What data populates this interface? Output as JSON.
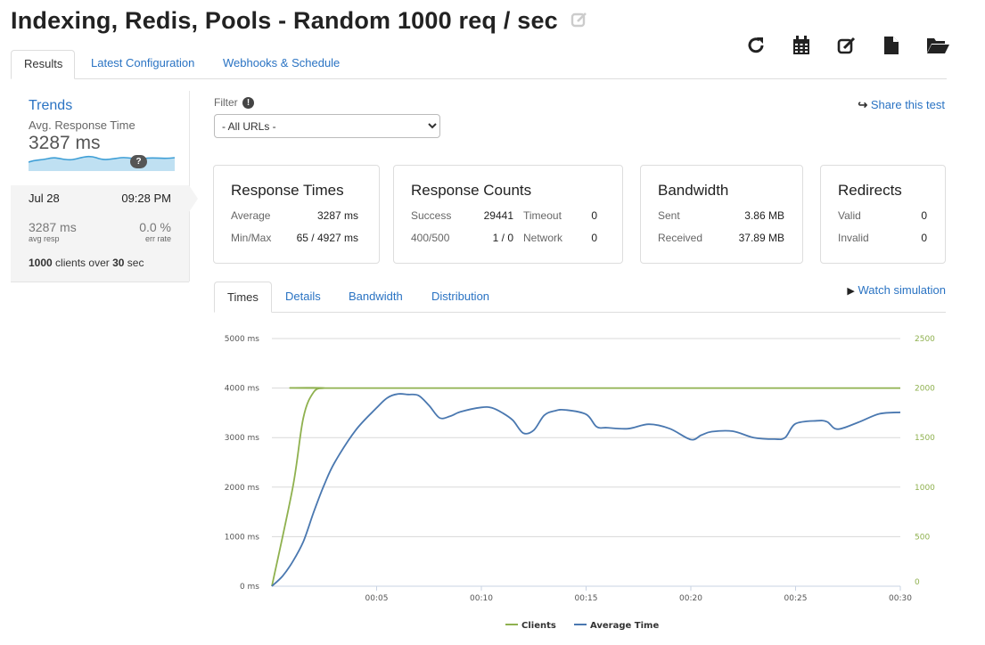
{
  "header": {
    "title": "Indexing, Redis, Pools - Random 1000 req / sec",
    "edit_icon": "edit-icon",
    "toolbar_icons": [
      "refresh-icon",
      "calendar-icon",
      "edit-icon",
      "file-icon",
      "folder-open-icon"
    ]
  },
  "top_tabs": [
    "Results",
    "Latest Configuration",
    "Webhooks & Schedule"
  ],
  "sidebar": {
    "trends_label": "Trends",
    "avg_label": "Avg. Response Time",
    "avg_value": "3287 ms",
    "help_badge": "?",
    "date": "Jul 28",
    "time": "09:28 PM",
    "resp_value": "3287 ms",
    "resp_caption": "avg resp",
    "err_value": "0.0 %",
    "err_caption": "err rate",
    "clients_count": "1000",
    "clients_text": "clients over",
    "duration": "30",
    "duration_unit": "sec"
  },
  "filter": {
    "label": "Filter",
    "info_glyph": "!",
    "selected": "- All URLs -"
  },
  "share_label": "Share this test",
  "cards": {
    "response_times": {
      "title": "Response Times",
      "average_label": "Average",
      "average_value": "3287 ms",
      "minmax_label": "Min/Max",
      "minmax_value": "65 / 4927 ms"
    },
    "response_counts": {
      "title": "Response Counts",
      "success_label": "Success",
      "success_value": "29441",
      "timeout_label": "Timeout",
      "timeout_value": "0",
      "err_label": "400/500",
      "err_value": "1 / 0",
      "network_label": "Network",
      "network_value": "0"
    },
    "bandwidth": {
      "title": "Bandwidth",
      "sent_label": "Sent",
      "sent_value": "3.86 MB",
      "received_label": "Received",
      "received_value": "37.89 MB"
    },
    "redirects": {
      "title": "Redirects",
      "valid_label": "Valid",
      "valid_value": "0",
      "invalid_label": "Invalid",
      "invalid_value": "0"
    }
  },
  "chart_tabs": [
    "Times",
    "Details",
    "Bandwidth",
    "Distribution"
  ],
  "watch_label": "Watch simulation",
  "colors": {
    "accent": "#2a73c3",
    "clients": "#8fb14f",
    "avg_time": "#4a78b0",
    "spark_fill": "#bfe0f2",
    "spark_line": "#3f9fd6"
  },
  "chart_data": {
    "type": "line",
    "x_ticks": [
      "00:05",
      "00:10",
      "00:15",
      "00:20",
      "00:25",
      "00:30"
    ],
    "y_left_ticks": [
      "0 ms",
      "1000 ms",
      "2000 ms",
      "3000 ms",
      "4000 ms",
      "5000 ms"
    ],
    "y_right_ticks": [
      "0",
      "500",
      "1000",
      "1500",
      "2000",
      "2500"
    ],
    "ylim_left": [
      0,
      5000
    ],
    "ylim_right": [
      0,
      2500
    ],
    "xlim": [
      0,
      30
    ],
    "grid": true,
    "legend_position": "bottom-center",
    "series": [
      {
        "name": "Clients",
        "axis": "right",
        "x": [
          0,
          1,
          1.5,
          2,
          2.5,
          3,
          30
        ],
        "values": [
          0,
          1000,
          1700,
          1960,
          2000,
          2000,
          2000
        ]
      },
      {
        "name": "Average Time",
        "axis": "left",
        "x": [
          0,
          0.5,
          1,
          1.5,
          2,
          2.5,
          3,
          4,
          5,
          5.5,
          6,
          6.5,
          7,
          7.5,
          8,
          8.5,
          9,
          10,
          10.5,
          11,
          11.5,
          12,
          12.5,
          13,
          13.5,
          14,
          15,
          15.5,
          16,
          17,
          18,
          19,
          20,
          20.5,
          21,
          22,
          23,
          24,
          24.5,
          25,
          26,
          26.5,
          27,
          28,
          29,
          30
        ],
        "values": [
          0,
          200,
          500,
          900,
          1500,
          2050,
          2500,
          3150,
          3600,
          3800,
          3880,
          3870,
          3850,
          3650,
          3400,
          3430,
          3520,
          3610,
          3600,
          3500,
          3350,
          3090,
          3150,
          3450,
          3540,
          3560,
          3470,
          3220,
          3200,
          3180,
          3270,
          3180,
          2960,
          3050,
          3120,
          3130,
          3000,
          2970,
          3000,
          3280,
          3340,
          3320,
          3170,
          3310,
          3480,
          3510
        ]
      }
    ]
  }
}
